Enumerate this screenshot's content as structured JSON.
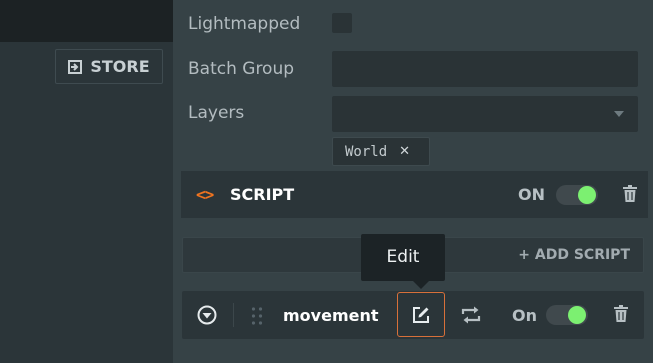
{
  "toolbar": {
    "store_label": "STORE"
  },
  "properties": {
    "lightmapped": {
      "label": "Lightmapped",
      "checked": false
    },
    "batch_group": {
      "label": "Batch Group",
      "value": ""
    },
    "layers": {
      "label": "Layers",
      "value": "",
      "tags": [
        "World"
      ]
    }
  },
  "script_component": {
    "title": "SCRIPT",
    "enabled_label": "ON",
    "enabled": true,
    "add_script_label": "+ ADD SCRIPT",
    "scripts": [
      {
        "name": "movement",
        "state_label": "On",
        "enabled": true
      }
    ]
  },
  "tooltip": {
    "text": "Edit"
  },
  "colors": {
    "accent": "#f0741f",
    "toggle_on": "#7cf071",
    "edit_border": "#d8703a"
  },
  "icons": [
    "store-icon",
    "code-icon",
    "trash-icon",
    "collapse-icon",
    "grip-icon",
    "edit-icon",
    "swap-icon",
    "close-icon",
    "dropdown-arrow-icon"
  ]
}
